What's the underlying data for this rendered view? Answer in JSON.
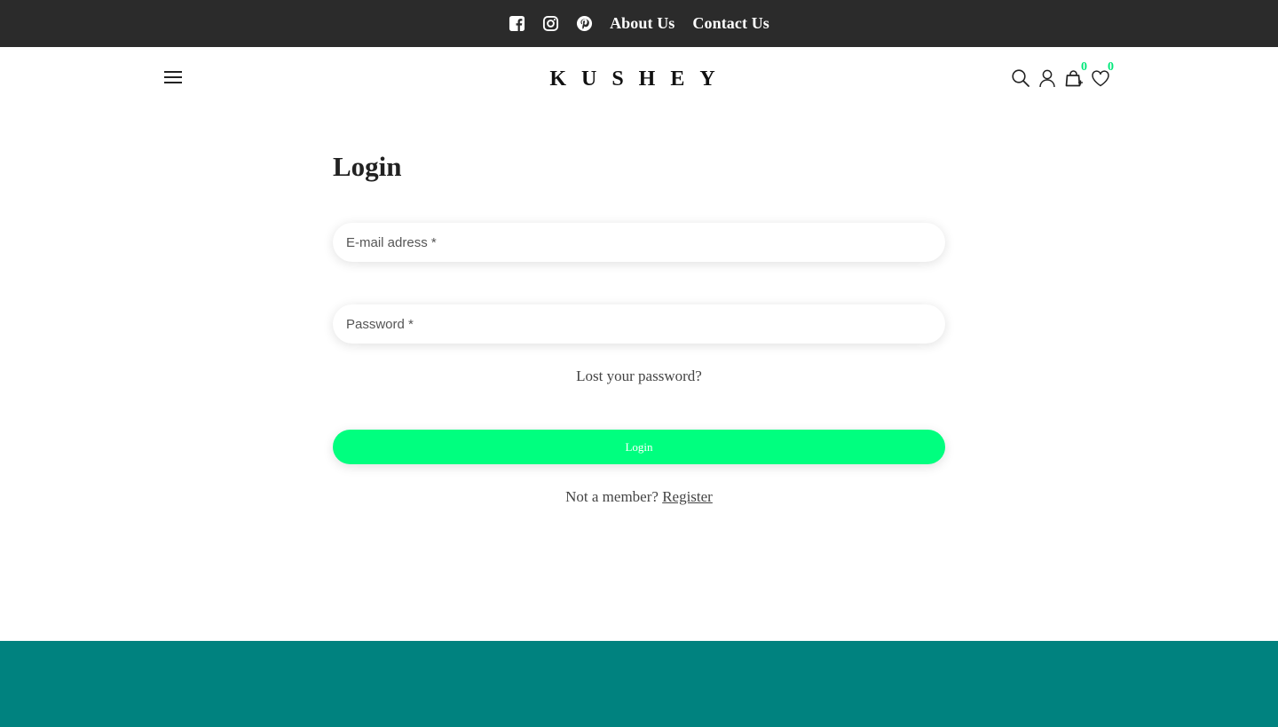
{
  "colors": {
    "topbar_bg": "#2b2b2b",
    "accent_green": "#00ff7f",
    "badge_green": "#00e87a",
    "footer_teal": "#00827f"
  },
  "topbar": {
    "social_icons": [
      "facebook-icon",
      "instagram-icon",
      "pinterest-icon"
    ],
    "links": {
      "about": "About Us",
      "contact": "Contact Us"
    }
  },
  "header": {
    "logo": "KUSHEY",
    "icons": [
      "menu-icon",
      "search-icon",
      "user-icon",
      "cart-icon",
      "heart-icon"
    ],
    "cart_count": "0",
    "wishlist_count": "0"
  },
  "login": {
    "title": "Login",
    "email_placeholder": "E-mail adress *",
    "password_placeholder": "Password *",
    "lost_password": "Lost your password?",
    "submit_label": "Login",
    "not_member": "Not a member?",
    "register_label": "Register"
  }
}
